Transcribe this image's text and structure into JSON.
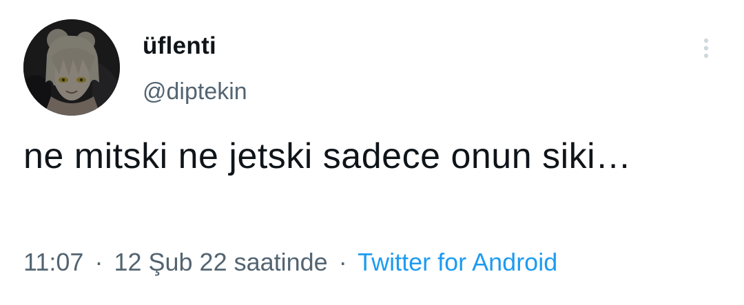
{
  "author": {
    "display_name": "üflenti",
    "handle": "@diptekin",
    "avatar_icon": "anime-character-avatar"
  },
  "tweet": {
    "text": "ne mitski ne jetski sadece onun siki…"
  },
  "meta": {
    "time": "11:07",
    "separator": "·",
    "date": "12 Şub 22 saatinde",
    "source": "Twitter for Android"
  },
  "actions": {
    "more_icon": "vertical-ellipsis-icon"
  },
  "colors": {
    "text_primary": "#0f1419",
    "text_secondary": "#536471",
    "link": "#1d9bf0",
    "more_icon": "#cfd9de"
  }
}
